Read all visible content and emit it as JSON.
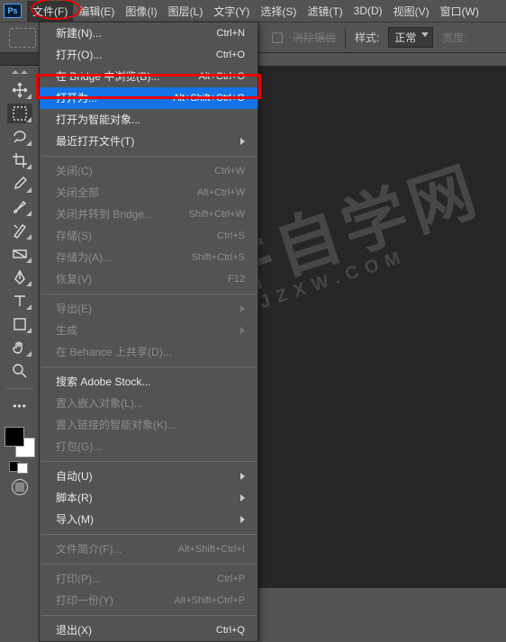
{
  "menubar": {
    "items": [
      {
        "label": "文件(F)"
      },
      {
        "label": "编辑(E)"
      },
      {
        "label": "图像(I)"
      },
      {
        "label": "图层(L)"
      },
      {
        "label": "文字(Y)"
      },
      {
        "label": "选择(S)"
      },
      {
        "label": "滤镜(T)"
      },
      {
        "label": "3D(D)"
      },
      {
        "label": "视图(V)"
      },
      {
        "label": "窗口(W)"
      }
    ]
  },
  "optbar": {
    "feather_label": "消除锯齿",
    "style_label": "样式:",
    "style_value": "正常",
    "width_label": "宽度:"
  },
  "menu": {
    "groups": [
      [
        {
          "label": "新建(N)...",
          "shortcut": "Ctrl+N",
          "enabled": true
        },
        {
          "label": "打开(O)...",
          "shortcut": "Ctrl+O",
          "enabled": true
        },
        {
          "label": "在 Bridge 中浏览(B)...",
          "shortcut": "Alt+Ctrl+O",
          "enabled": true
        },
        {
          "label": "打开为...",
          "shortcut": "Alt+Shift+Ctrl+O",
          "enabled": true,
          "highlight": true
        },
        {
          "label": "打开为智能对象...",
          "shortcut": "",
          "enabled": true
        },
        {
          "label": "最近打开文件(T)",
          "shortcut": "",
          "enabled": true,
          "submenu": true
        }
      ],
      [
        {
          "label": "关闭(C)",
          "shortcut": "Ctrl+W",
          "enabled": false
        },
        {
          "label": "关闭全部",
          "shortcut": "Alt+Ctrl+W",
          "enabled": false
        },
        {
          "label": "关闭并转到 Bridge...",
          "shortcut": "Shift+Ctrl+W",
          "enabled": false
        },
        {
          "label": "存储(S)",
          "shortcut": "Ctrl+S",
          "enabled": false
        },
        {
          "label": "存储为(A)...",
          "shortcut": "Shift+Ctrl+S",
          "enabled": false
        },
        {
          "label": "恢复(V)",
          "shortcut": "F12",
          "enabled": false
        }
      ],
      [
        {
          "label": "导出(E)",
          "shortcut": "",
          "enabled": false,
          "submenu": true
        },
        {
          "label": "生成",
          "shortcut": "",
          "enabled": false,
          "submenu": true
        },
        {
          "label": "在 Behance 上共享(D)...",
          "shortcut": "",
          "enabled": false
        }
      ],
      [
        {
          "label": "搜索 Adobe Stock...",
          "shortcut": "",
          "enabled": true
        },
        {
          "label": "置入嵌入对象(L)...",
          "shortcut": "",
          "enabled": false
        },
        {
          "label": "置入链接的智能对象(K)...",
          "shortcut": "",
          "enabled": false
        },
        {
          "label": "打包(G)...",
          "shortcut": "",
          "enabled": false
        }
      ],
      [
        {
          "label": "自动(U)",
          "shortcut": "",
          "enabled": true,
          "submenu": true
        },
        {
          "label": "脚本(R)",
          "shortcut": "",
          "enabled": true,
          "submenu": true
        },
        {
          "label": "导入(M)",
          "shortcut": "",
          "enabled": true,
          "submenu": true
        }
      ],
      [
        {
          "label": "文件简介(F)...",
          "shortcut": "Alt+Shift+Ctrl+I",
          "enabled": false
        }
      ],
      [
        {
          "label": "打印(P)...",
          "shortcut": "Ctrl+P",
          "enabled": false
        },
        {
          "label": "打印一份(Y)",
          "shortcut": "Alt+Shift+Ctrl+P",
          "enabled": false
        }
      ],
      [
        {
          "label": "退出(X)",
          "shortcut": "Ctrl+Q",
          "enabled": true
        }
      ]
    ]
  },
  "watermark": {
    "big": "软件自学网",
    "small": "RJZXW.COM"
  },
  "ps": "Ps"
}
